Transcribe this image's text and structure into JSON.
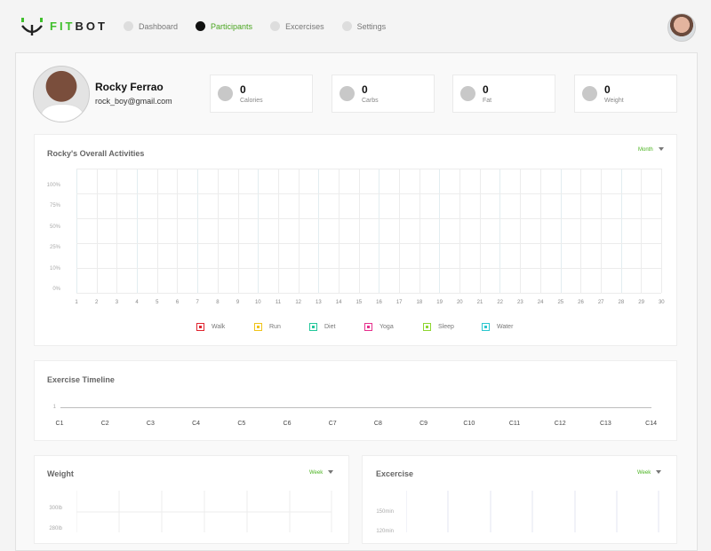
{
  "header": {
    "brand": {
      "part1": "FIT",
      "part2": "BOT"
    },
    "nav": [
      {
        "label": "Dashboard",
        "active": false
      },
      {
        "label": "Participants",
        "active": true
      },
      {
        "label": "Excercises",
        "active": false
      },
      {
        "label": "Settings",
        "active": false
      }
    ]
  },
  "profile": {
    "name": "Rocky Ferrao",
    "email": "rock_boy@gmail.com"
  },
  "stats": [
    {
      "value": "0",
      "label": "Calories"
    },
    {
      "value": "0",
      "label": "Carbs"
    },
    {
      "value": "0",
      "label": "Fat"
    },
    {
      "value": "0",
      "label": "Weight"
    }
  ],
  "activities": {
    "title": "Rocky's Overall Activities",
    "period": "Month",
    "y_ticks": [
      "100%",
      "75%",
      "50%",
      "25%",
      "10%",
      "0%"
    ],
    "x_ticks": [
      "1",
      "2",
      "3",
      "4",
      "5",
      "6",
      "7",
      "8",
      "9",
      "10",
      "11",
      "12",
      "13",
      "14",
      "15",
      "16",
      "17",
      "18",
      "19",
      "20",
      "21",
      "22",
      "23",
      "24",
      "25",
      "26",
      "27",
      "28",
      "29",
      "30"
    ],
    "legend": [
      {
        "label": "Walk",
        "color": "#e0242f"
      },
      {
        "label": "Run",
        "color": "#f0c419"
      },
      {
        "label": "Diet",
        "color": "#22c79a"
      },
      {
        "label": "Yoga",
        "color": "#e62f8d"
      },
      {
        "label": "Sleep",
        "color": "#8ed631"
      },
      {
        "label": "Water",
        "color": "#2bc7cf"
      }
    ]
  },
  "timeline": {
    "title": "Exercise Timeline",
    "y_tick": "1",
    "labels": [
      "C1",
      "C2",
      "C3",
      "C4",
      "C5",
      "C6",
      "C7",
      "C8",
      "C9",
      "C10",
      "C11",
      "C12",
      "C13",
      "C14"
    ]
  },
  "weight": {
    "title": "Weight",
    "period": "Week",
    "y_ticks": [
      "300lb",
      "280lb"
    ]
  },
  "exercise": {
    "title": "Excercise",
    "period": "Week",
    "y_ticks": [
      "150min",
      "120min"
    ]
  },
  "colors": {
    "accent": "#4ab31f",
    "grid": "#e6e6e6"
  }
}
